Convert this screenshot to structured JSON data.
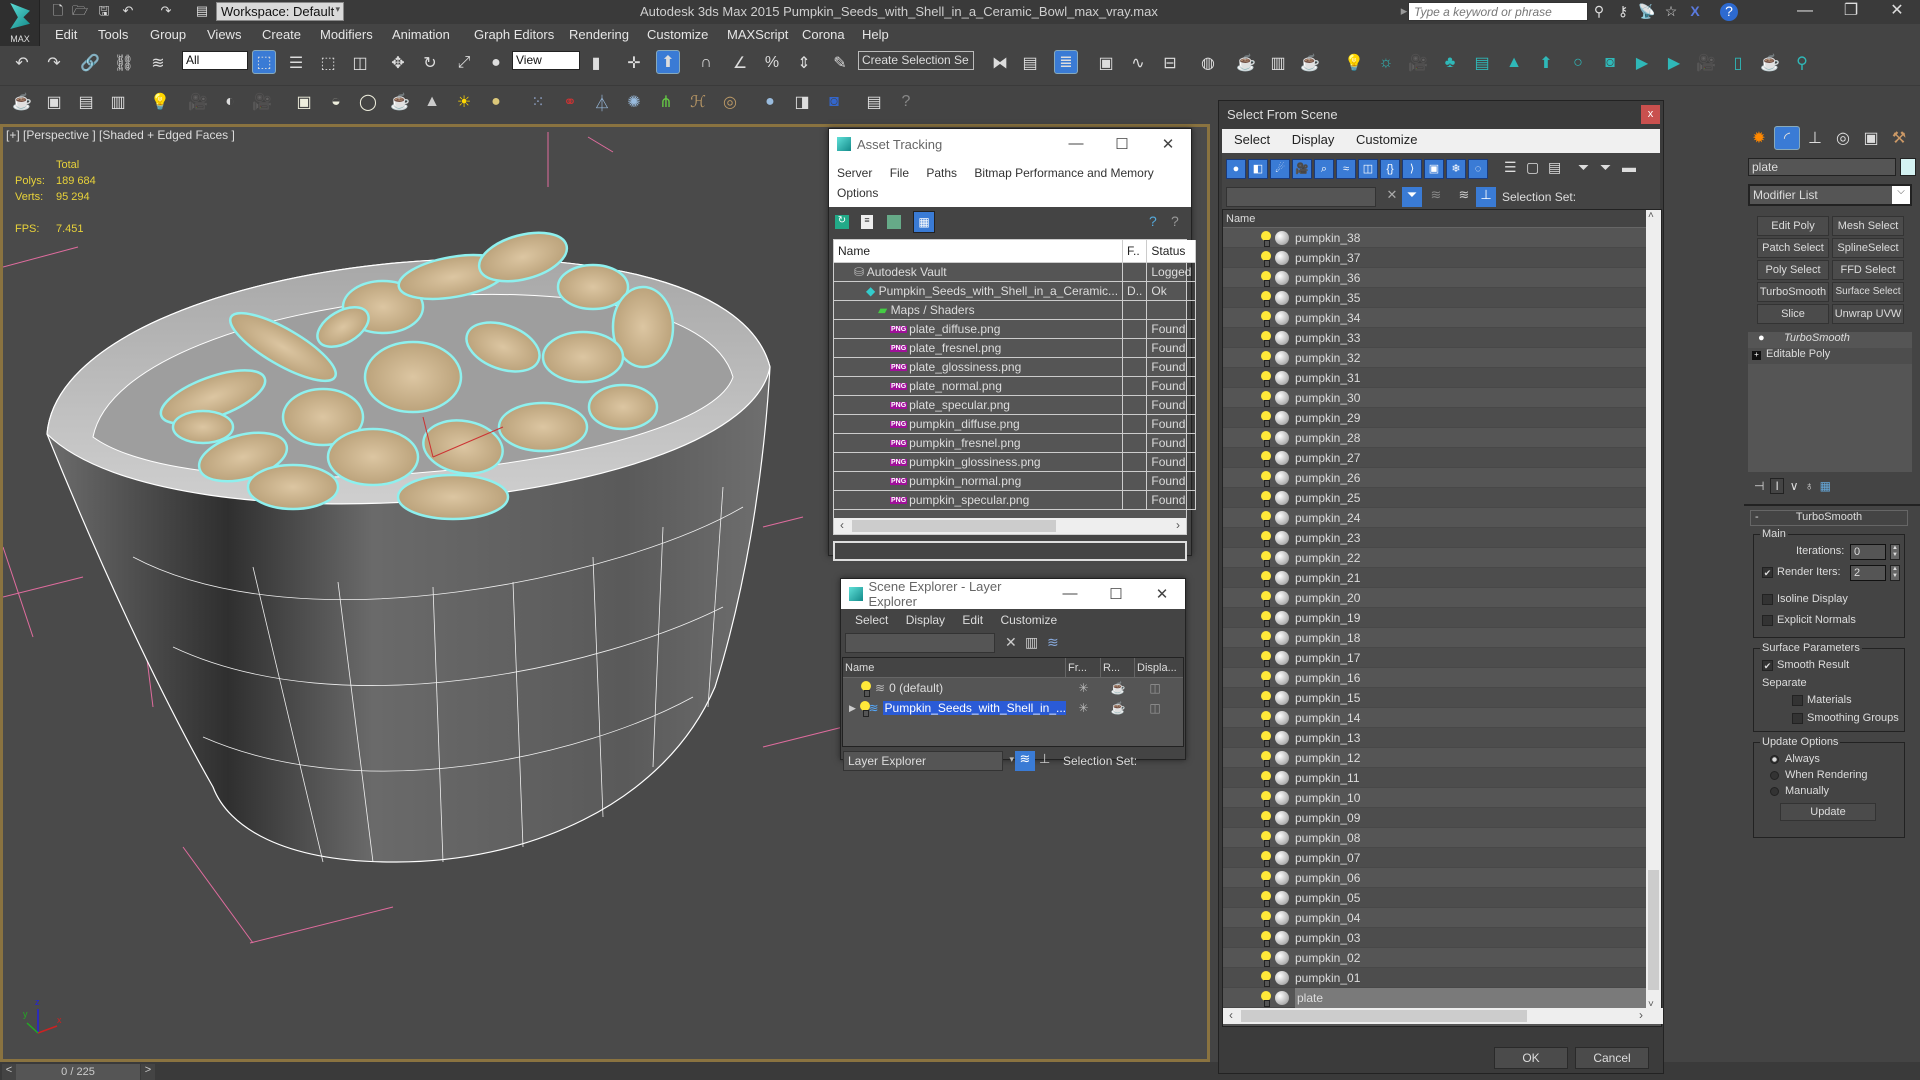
{
  "app": {
    "logo_label": "MAX",
    "title": "Autodesk 3ds Max  2015    Pumpkin_Seeds_with_Shell_in_a_Ceramic_Bowl_max_vray.max",
    "workspace": "Workspace: Default",
    "search_placeholder": "Type a keyword or phrase"
  },
  "menu": [
    "Edit",
    "Tools",
    "Group",
    "Views",
    "Create",
    "Modifiers",
    "Animation",
    "Graph Editors",
    "Rendering",
    "Customize",
    "MAXScript",
    "Corona",
    "Help"
  ],
  "toolbar": {
    "selection_filter": "All",
    "reference_coord": "View",
    "named_selection_placeholder": "Create Selection Se"
  },
  "viewport": {
    "label": "[+] [Perspective ] [Shaded + Edged Faces ]",
    "stats_header": "Total",
    "polys_label": "Polys:",
    "polys": "189 684",
    "verts_label": "Verts:",
    "verts": "95 294",
    "fps_label": "FPS:",
    "fps": "7.451",
    "axis": {
      "x": "x",
      "y": "y",
      "z": "z"
    }
  },
  "timeline": {
    "frame": "0 / 225",
    "prev": "<",
    "next": ">"
  },
  "asset_tracking": {
    "title": "Asset Tracking",
    "menu": [
      "Server",
      "File",
      "Paths",
      "Bitmap Performance and Memory",
      "Options"
    ],
    "columns": [
      "Name",
      "F..",
      "Status"
    ],
    "rows": [
      {
        "name": "Autodesk Vault",
        "f": "",
        "status": "Logged",
        "level": 1,
        "icon": "vault"
      },
      {
        "name": "Pumpkin_Seeds_with_Shell_in_a_Ceramic...",
        "f": "D..",
        "status": "Ok",
        "level": 2,
        "icon": "max"
      },
      {
        "name": "Maps / Shaders",
        "f": "",
        "status": "",
        "level": 3,
        "icon": "maps"
      },
      {
        "name": "plate_diffuse.png",
        "f": "",
        "status": "Found",
        "level": 4,
        "icon": "png"
      },
      {
        "name": "plate_fresnel.png",
        "f": "",
        "status": "Found",
        "level": 4,
        "icon": "png"
      },
      {
        "name": "plate_glossiness.png",
        "f": "",
        "status": "Found",
        "level": 4,
        "icon": "png"
      },
      {
        "name": "plate_normal.png",
        "f": "",
        "status": "Found",
        "level": 4,
        "icon": "png"
      },
      {
        "name": "plate_specular.png",
        "f": "",
        "status": "Found",
        "level": 4,
        "icon": "png"
      },
      {
        "name": "pumpkin_diffuse.png",
        "f": "",
        "status": "Found",
        "level": 4,
        "icon": "png"
      },
      {
        "name": "pumpkin_fresnel.png",
        "f": "",
        "status": "Found",
        "level": 4,
        "icon": "png"
      },
      {
        "name": "pumpkin_glossiness.png",
        "f": "",
        "status": "Found",
        "level": 4,
        "icon": "png"
      },
      {
        "name": "pumpkin_normal.png",
        "f": "",
        "status": "Found",
        "level": 4,
        "icon": "png"
      },
      {
        "name": "pumpkin_specular.png",
        "f": "",
        "status": "Found",
        "level": 4,
        "icon": "png"
      }
    ]
  },
  "layer_explorer": {
    "title": "Scene Explorer - Layer Explorer",
    "menu": [
      "Select",
      "Display",
      "Edit",
      "Customize"
    ],
    "columns": [
      "Name",
      "Fr...",
      "R...",
      "Displa..."
    ],
    "rows": [
      {
        "name": "0 (default)",
        "selected": false
      },
      {
        "name": "Pumpkin_Seeds_with_Shell_in_...",
        "selected": true
      }
    ],
    "mode": "Layer Explorer",
    "selection_set_label": "Selection Set:"
  },
  "select_from_scene": {
    "title": "Select From Scene",
    "close": "x",
    "menu": [
      "Select",
      "Display",
      "Customize"
    ],
    "selection_set_label": "Selection Set:",
    "column": "Name",
    "items": [
      "pumpkin_38",
      "pumpkin_37",
      "pumpkin_36",
      "pumpkin_35",
      "pumpkin_34",
      "pumpkin_33",
      "pumpkin_32",
      "pumpkin_31",
      "pumpkin_30",
      "pumpkin_29",
      "pumpkin_28",
      "pumpkin_27",
      "pumpkin_26",
      "pumpkin_25",
      "pumpkin_24",
      "pumpkin_23",
      "pumpkin_22",
      "pumpkin_21",
      "pumpkin_20",
      "pumpkin_19",
      "pumpkin_18",
      "pumpkin_17",
      "pumpkin_16",
      "pumpkin_15",
      "pumpkin_14",
      "pumpkin_13",
      "pumpkin_12",
      "pumpkin_11",
      "pumpkin_10",
      "pumpkin_09",
      "pumpkin_08",
      "pumpkin_07",
      "pumpkin_06",
      "pumpkin_05",
      "pumpkin_04",
      "pumpkin_03",
      "pumpkin_02",
      "pumpkin_01",
      "plate"
    ],
    "selected_item": "plate",
    "ok": "OK",
    "cancel": "Cancel"
  },
  "command_panel": {
    "object_name": "plate",
    "object_color": "#d4f2f2",
    "modifier_list": "Modifier List",
    "buttons": [
      "Edit Poly",
      "Mesh Select",
      "Patch Select",
      "SplineSelect",
      "Poly Select",
      "FFD Select",
      "TurboSmooth",
      "Surface Select",
      "Slice",
      "Unwrap UVW"
    ],
    "stack": [
      "TurboSmooth",
      "Editable Poly"
    ],
    "rollout_title": "TurboSmooth",
    "main_group": "Main",
    "iterations_label": "Iterations:",
    "iterations": "0",
    "render_iters_label": "Render Iters:",
    "render_iters": "2",
    "render_iters_checked": true,
    "isoline_label": "Isoline Display",
    "explicit_label": "Explicit Normals",
    "surface_group": "Surface Parameters",
    "smooth_result_label": "Smooth Result",
    "separate_label": "Separate",
    "materials_label": "Materials",
    "smoothing_groups_label": "Smoothing Groups",
    "update_group": "Update Options",
    "update_options": [
      "Always",
      "When Rendering",
      "Manually"
    ],
    "update_selected": "Always",
    "update_button": "Update"
  }
}
